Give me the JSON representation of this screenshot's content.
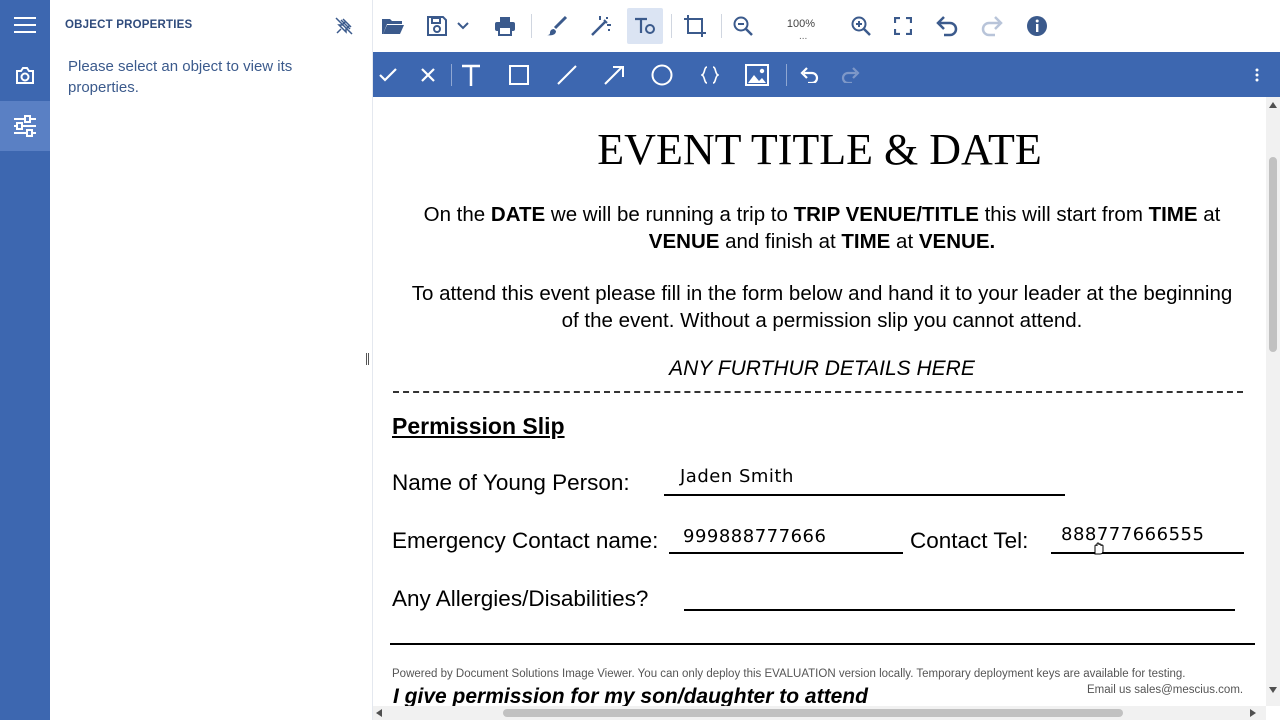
{
  "panel": {
    "title": "OBJECT PROPERTIES",
    "message": "Please select an object to view its properties."
  },
  "toolbar": {
    "zoom": "100%"
  },
  "document": {
    "title": "EVENT TITLE & DATE",
    "para1": {
      "t1": "On the ",
      "b1": "DATE",
      "t2": " we will be running a trip to ",
      "b2": "TRIP VENUE/TITLE",
      "t3": " this will start from ",
      "b3": "TIME",
      "t4": " at ",
      "b4": "VENUE",
      "t5": " and finish at ",
      "b5": "TIME",
      "t6": " at ",
      "b6": "VENUE."
    },
    "para2": "To attend this event please fill in the form below and hand it to your leader at the beginning of the event. Without a permission slip you cannot attend.",
    "details": "ANY FURTHUR DETAILS HERE",
    "slip_heading": "Permission Slip",
    "fields": {
      "name_label": "Name of Young Person:",
      "name_value": "Jaden Smith",
      "emergency_label": "Emergency Contact name:",
      "emergency_value": "999888777666",
      "tel_label": "Contact Tel:",
      "tel_value": "888777666555",
      "allergies_label": "Any Allergies/Disabilities?"
    },
    "powered_by": "Powered by Document Solutions Image Viewer. You can only deploy this EVALUATION version locally. Temporary deployment keys are available for testing.",
    "email": "Email us sales@mescius.com.",
    "bottom_text": "I give permission for my son/daughter to attend"
  },
  "colors": {
    "primary": "#3d67b0",
    "active_toolbar": "#dbe4f3",
    "icon": "#3b5a8c",
    "icon_disabled": "#b8c4d9"
  }
}
